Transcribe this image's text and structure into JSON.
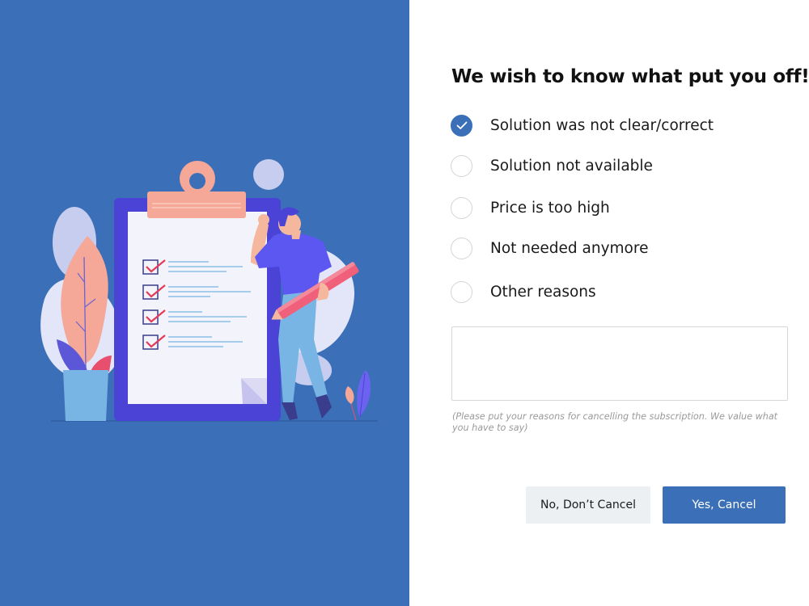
{
  "form": {
    "title": "We wish to know what put you off!",
    "options": [
      {
        "label": "Solution was not clear/correct",
        "checked": true
      },
      {
        "label": "Solution not available",
        "checked": false
      },
      {
        "label": "Price is too high",
        "checked": false
      },
      {
        "label": "Not needed anymore",
        "checked": false
      },
      {
        "label": "Other reasons",
        "checked": false
      }
    ],
    "reason_input": {
      "value": "",
      "placeholder": ""
    },
    "hint": "(Please put your reasons for cancelling the subscription. We value what you have to say)"
  },
  "actions": {
    "no_label": "No, Don’t Cancel",
    "yes_label": "Yes, Cancel"
  },
  "icons": {
    "check": "check-icon",
    "illustration": "checklist-illustration"
  },
  "colors": {
    "accent": "#3b70b8",
    "panel": "#3b70b8",
    "secondary_button": "#edf0f3"
  }
}
